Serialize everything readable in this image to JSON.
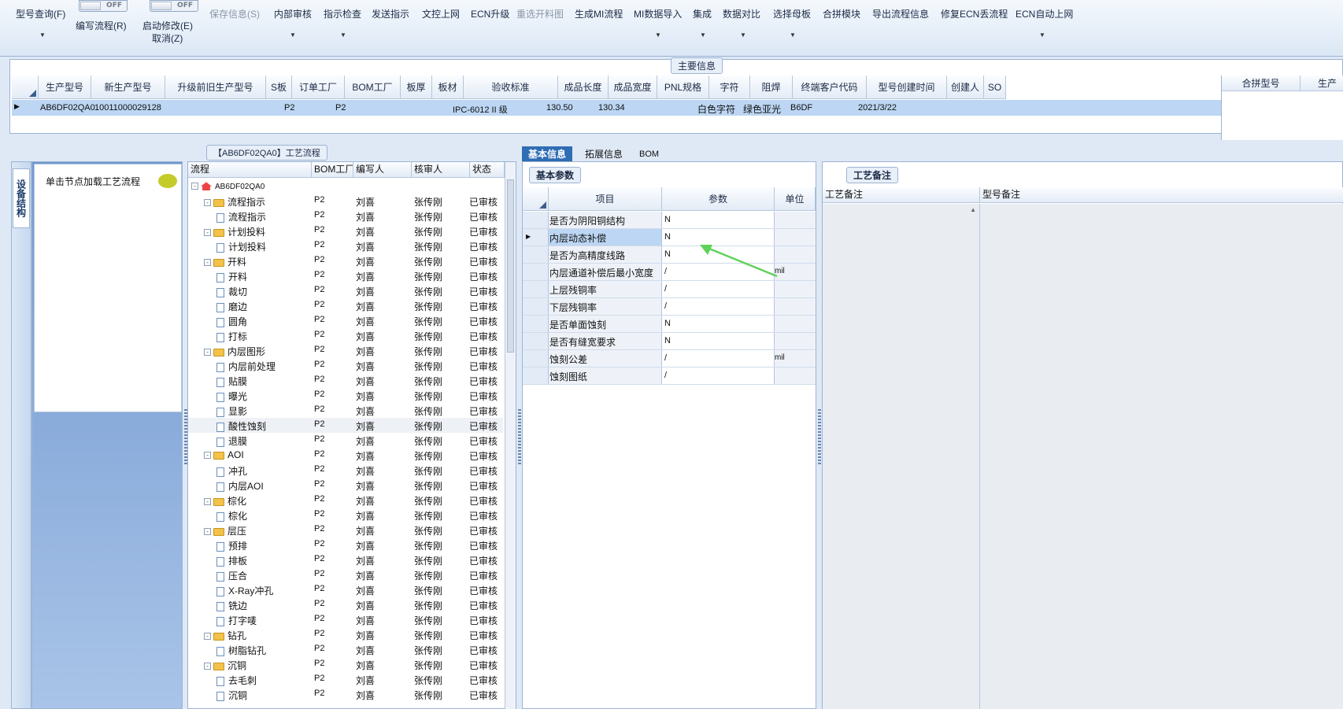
{
  "ribbon": {
    "buttons": [
      {
        "label": "型号查询(F)",
        "disabled": false
      },
      {
        "label": "编写流程(R)",
        "disabled": false
      },
      {
        "label": "启动修改(E)",
        "disabled": false
      },
      {
        "label": "取消(Z)",
        "disabled": false
      },
      {
        "label": "保存信息(S)",
        "disabled": true
      },
      {
        "label": "内部审核",
        "disabled": false
      },
      {
        "label": "指示检查",
        "disabled": false
      },
      {
        "label": "发送指示",
        "disabled": false
      },
      {
        "label": "文控上网",
        "disabled": false
      },
      {
        "label": "ECN升级",
        "disabled": false
      },
      {
        "label": "重选开料图",
        "disabled": true
      },
      {
        "label": "生成MI流程",
        "disabled": false
      },
      {
        "label": "MI数据导入",
        "disabled": false
      },
      {
        "label": "集成",
        "disabled": false
      },
      {
        "label": "数据对比",
        "disabled": false
      },
      {
        "label": "选择母板",
        "disabled": false
      },
      {
        "label": "合拼模块",
        "disabled": false
      },
      {
        "label": "导出流程信息",
        "disabled": false
      },
      {
        "label": "修复ECN丢流程",
        "disabled": false
      },
      {
        "label": "ECN自动上网",
        "disabled": false
      }
    ],
    "toggle_text": "OFF"
  },
  "main_info": {
    "title": "主要信息",
    "columns": [
      "生产型号",
      "新生产型号",
      "升级前旧生产型号",
      "S板",
      "订单工厂",
      "BOM工厂",
      "板厚",
      "板材",
      "验收标准",
      "成品长度",
      "成品宽度",
      "PNL规格",
      "字符",
      "阻焊",
      "终端客户代码",
      "型号创建时间",
      "创建人",
      "SO"
    ],
    "row": [
      "AB6DF02QA0",
      "10011000029128",
      "",
      "",
      "P2",
      "P2",
      "",
      "",
      "IPC-6012 II 级",
      "130.50",
      "130.34",
      "",
      "白色字符",
      "绿色亚光",
      "B6DF",
      "2021/3/22",
      "",
      ""
    ],
    "right_columns": [
      "合拼型号",
      "生产"
    ]
  },
  "left_panel": {
    "vertical_tab": "设备结构",
    "hint": "单击节点加载工艺流程"
  },
  "flow_panel": {
    "title": "【AB6DF02QA0】工艺流程",
    "columns": [
      "流程",
      "BOM工厂",
      "编写人",
      "核审人",
      "状态"
    ],
    "root": "AB6DF02QA0",
    "rows": [
      {
        "name": "流程指示",
        "type": "folder",
        "bom": "P2",
        "writer": "刘喜",
        "reviewer": "张传刚",
        "status": "已审核"
      },
      {
        "name": "流程指示",
        "type": "leaf",
        "bom": "P2",
        "writer": "刘喜",
        "reviewer": "张传刚",
        "status": "已审核"
      },
      {
        "name": "计划投料",
        "type": "folder",
        "bom": "P2",
        "writer": "刘喜",
        "reviewer": "张传刚",
        "status": "已审核"
      },
      {
        "name": "计划投料",
        "type": "leaf",
        "bom": "P2",
        "writer": "刘喜",
        "reviewer": "张传刚",
        "status": "已审核"
      },
      {
        "name": "开料",
        "type": "folder",
        "bom": "P2",
        "writer": "刘喜",
        "reviewer": "张传刚",
        "status": "已审核"
      },
      {
        "name": "开料",
        "type": "leaf",
        "bom": "P2",
        "writer": "刘喜",
        "reviewer": "张传刚",
        "status": "已审核"
      },
      {
        "name": "裁切",
        "type": "leaf",
        "bom": "P2",
        "writer": "刘喜",
        "reviewer": "张传刚",
        "status": "已审核"
      },
      {
        "name": "磨边",
        "type": "leaf",
        "bom": "P2",
        "writer": "刘喜",
        "reviewer": "张传刚",
        "status": "已审核"
      },
      {
        "name": "圆角",
        "type": "leaf",
        "bom": "P2",
        "writer": "刘喜",
        "reviewer": "张传刚",
        "status": "已审核"
      },
      {
        "name": "打标",
        "type": "leaf",
        "bom": "P2",
        "writer": "刘喜",
        "reviewer": "张传刚",
        "status": "已审核"
      },
      {
        "name": "内层图形",
        "type": "folder",
        "bom": "P2",
        "writer": "刘喜",
        "reviewer": "张传刚",
        "status": "已审核"
      },
      {
        "name": "内层前处理",
        "type": "leaf",
        "bom": "P2",
        "writer": "刘喜",
        "reviewer": "张传刚",
        "status": "已审核"
      },
      {
        "name": "贴膜",
        "type": "leaf",
        "bom": "P2",
        "writer": "刘喜",
        "reviewer": "张传刚",
        "status": "已审核"
      },
      {
        "name": "曝光",
        "type": "leaf",
        "bom": "P2",
        "writer": "刘喜",
        "reviewer": "张传刚",
        "status": "已审核"
      },
      {
        "name": "显影",
        "type": "leaf",
        "bom": "P2",
        "writer": "刘喜",
        "reviewer": "张传刚",
        "status": "已审核"
      },
      {
        "name": "酸性蚀刻",
        "type": "leaf",
        "bom": "P2",
        "writer": "刘喜",
        "reviewer": "张传刚",
        "status": "已审核"
      },
      {
        "name": "退膜",
        "type": "leaf",
        "bom": "P2",
        "writer": "刘喜",
        "reviewer": "张传刚",
        "status": "已审核"
      },
      {
        "name": "AOI",
        "type": "folder",
        "bom": "P2",
        "writer": "刘喜",
        "reviewer": "张传刚",
        "status": "已审核"
      },
      {
        "name": "冲孔",
        "type": "leaf",
        "bom": "P2",
        "writer": "刘喜",
        "reviewer": "张传刚",
        "status": "已审核"
      },
      {
        "name": "内层AOI",
        "type": "leaf",
        "bom": "P2",
        "writer": "刘喜",
        "reviewer": "张传刚",
        "status": "已审核"
      },
      {
        "name": "棕化",
        "type": "folder",
        "bom": "P2",
        "writer": "刘喜",
        "reviewer": "张传刚",
        "status": "已审核"
      },
      {
        "name": "棕化",
        "type": "leaf",
        "bom": "P2",
        "writer": "刘喜",
        "reviewer": "张传刚",
        "status": "已审核"
      },
      {
        "name": "层压",
        "type": "folder",
        "bom": "P2",
        "writer": "刘喜",
        "reviewer": "张传刚",
        "status": "已审核"
      },
      {
        "name": "预排",
        "type": "leaf",
        "bom": "P2",
        "writer": "刘喜",
        "reviewer": "张传刚",
        "status": "已审核"
      },
      {
        "name": "排板",
        "type": "leaf",
        "bom": "P2",
        "writer": "刘喜",
        "reviewer": "张传刚",
        "status": "已审核"
      },
      {
        "name": "压合",
        "type": "leaf",
        "bom": "P2",
        "writer": "刘喜",
        "reviewer": "张传刚",
        "status": "已审核"
      },
      {
        "name": "X-Ray冲孔",
        "type": "leaf",
        "bom": "P2",
        "writer": "刘喜",
        "reviewer": "张传刚",
        "status": "已审核"
      },
      {
        "name": "铣边",
        "type": "leaf",
        "bom": "P2",
        "writer": "刘喜",
        "reviewer": "张传刚",
        "status": "已审核"
      },
      {
        "name": "打字唛",
        "type": "leaf",
        "bom": "P2",
        "writer": "刘喜",
        "reviewer": "张传刚",
        "status": "已审核"
      },
      {
        "name": "钻孔",
        "type": "folder",
        "bom": "P2",
        "writer": "刘喜",
        "reviewer": "张传刚",
        "status": "已审核"
      },
      {
        "name": "树脂钻孔",
        "type": "leaf",
        "bom": "P2",
        "writer": "刘喜",
        "reviewer": "张传刚",
        "status": "已审核"
      },
      {
        "name": "沉铜",
        "type": "folder",
        "bom": "P2",
        "writer": "刘喜",
        "reviewer": "张传刚",
        "status": "已审核"
      },
      {
        "name": "去毛刺",
        "type": "leaf",
        "bom": "P2",
        "writer": "刘喜",
        "reviewer": "张传刚",
        "status": "已审核"
      },
      {
        "name": "沉铜",
        "type": "leaf",
        "bom": "P2",
        "writer": "刘喜",
        "reviewer": "张传刚",
        "status": "已审核"
      }
    ]
  },
  "tabs": [
    "基本信息",
    "拓展信息",
    "BOM"
  ],
  "params": {
    "group": "基本参数",
    "columns": [
      "项目",
      "参数",
      "单位"
    ],
    "rows": [
      {
        "item": "是否为阴阳铜结构",
        "value": "N",
        "unit": ""
      },
      {
        "item": "内层动态补偿",
        "value": "N",
        "unit": ""
      },
      {
        "item": "是否为高精度线路",
        "value": "N",
        "unit": ""
      },
      {
        "item": "内层通道补偿后最小宽度",
        "value": "/",
        "unit": "mil"
      },
      {
        "item": "上层残铜率",
        "value": "/",
        "unit": ""
      },
      {
        "item": "下层残铜率",
        "value": "/",
        "unit": ""
      },
      {
        "item": "是否单面蚀刻",
        "value": "N",
        "unit": ""
      },
      {
        "item": "是否有缝宽要求",
        "value": "N",
        "unit": ""
      },
      {
        "item": "蚀刻公差",
        "value": "/",
        "unit": "mil"
      },
      {
        "item": "蚀刻图纸",
        "value": "/",
        "unit": ""
      }
    ]
  },
  "notes": {
    "group": "工艺备注",
    "col1": "工艺备注",
    "col2": "型号备注"
  },
  "colors": {
    "selected_row": "#bcd6f3",
    "arrow": "#5fd25a",
    "tab_active": "#2f6db5"
  }
}
